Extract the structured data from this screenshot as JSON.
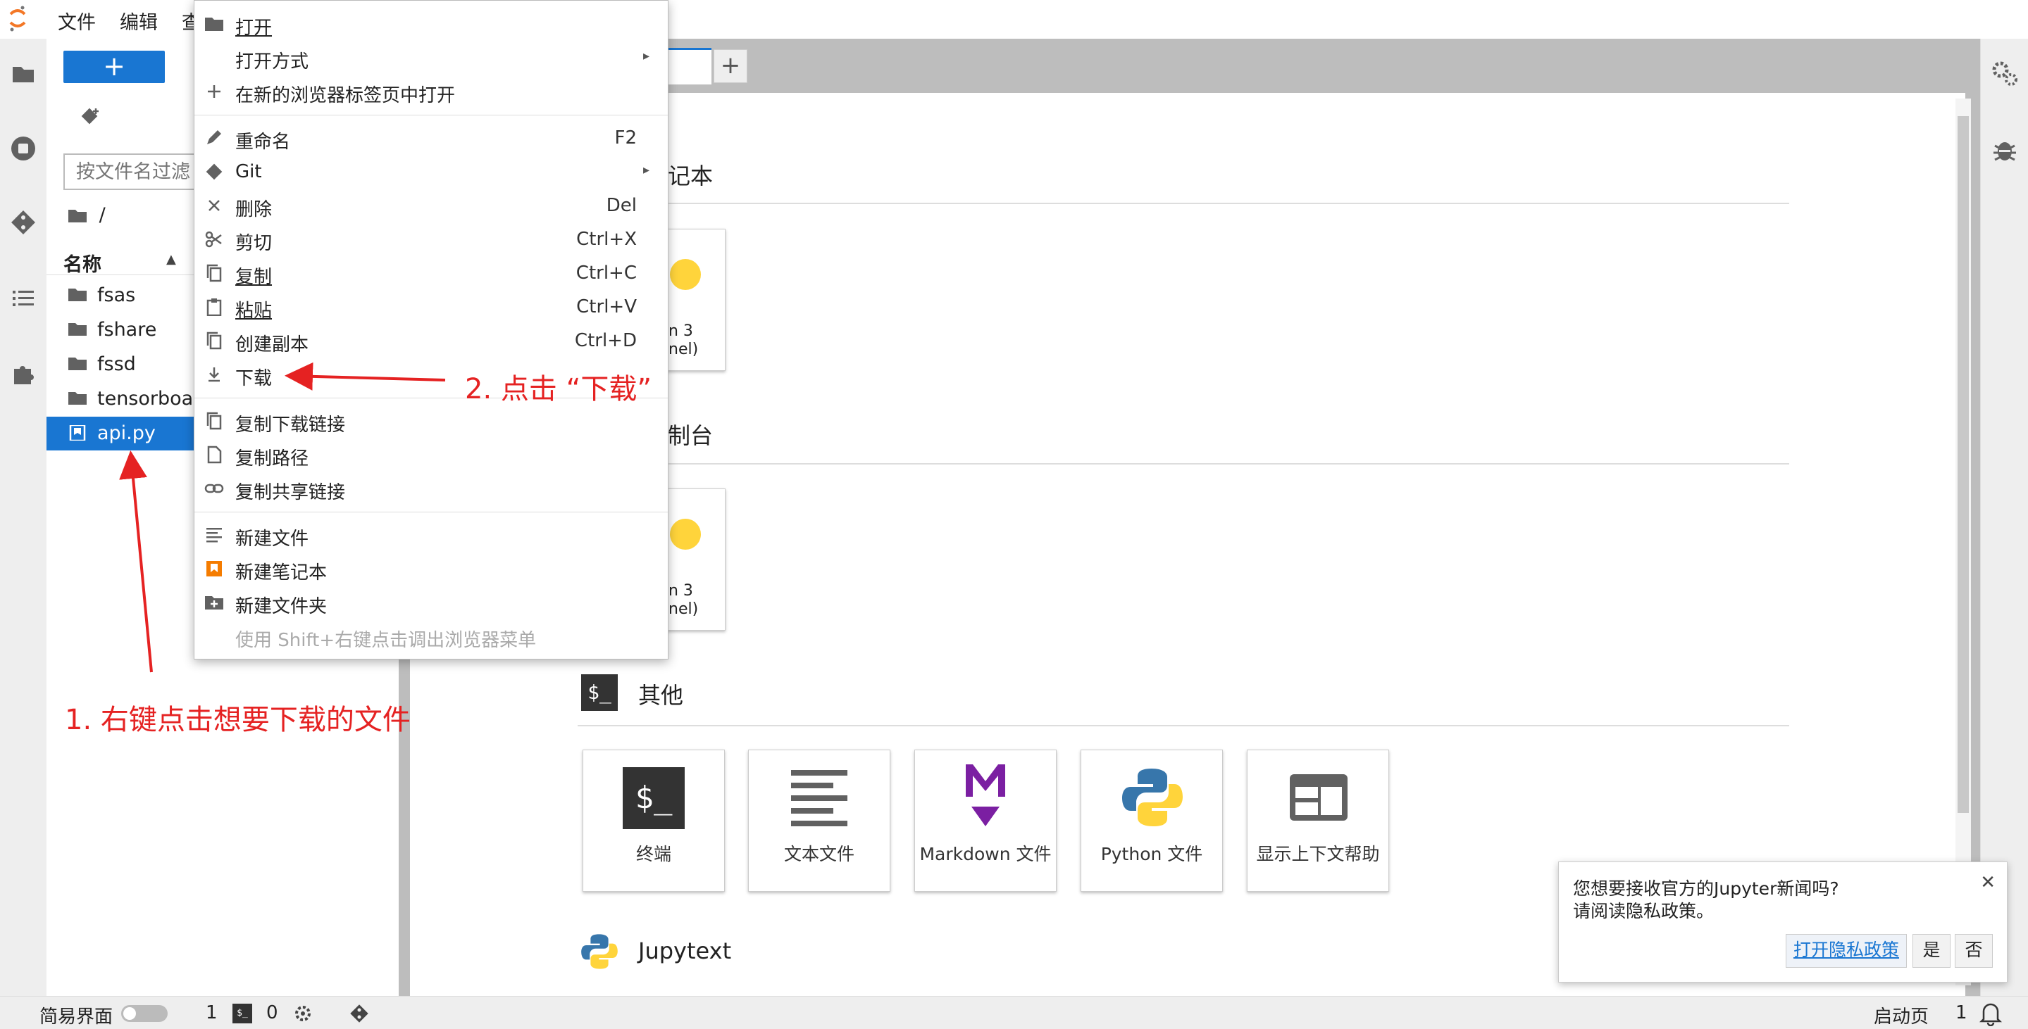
{
  "menubar": {
    "file": "文件",
    "edit": "编辑",
    "view_partial": "查"
  },
  "filebrowser": {
    "new_label": "+",
    "filter_placeholder": "按文件名过滤",
    "breadcrumb": "/",
    "column_name": "名称",
    "items": [
      {
        "name": "fsas",
        "type": "folder"
      },
      {
        "name": "fshare",
        "type": "folder"
      },
      {
        "name": "fssd",
        "type": "folder"
      },
      {
        "name": "tensorboa...",
        "type": "folder"
      },
      {
        "name": "api.py",
        "type": "file",
        "selected": true
      }
    ]
  },
  "launcher": {
    "tab_plus": "+",
    "notebook_section_partial": "记本",
    "console_section_partial": "制台",
    "kernel_partial_1": "n 3",
    "kernel_partial_2": "nel)",
    "other_section": "其他",
    "other_cards": [
      {
        "label": "终端",
        "icon": "terminal-icon"
      },
      {
        "label": "文本文件",
        "icon": "text-file-icon"
      },
      {
        "label": "Markdown 文件",
        "icon": "markdown-icon"
      },
      {
        "label": "Python 文件",
        "icon": "python-icon"
      },
      {
        "label": "显示上下文帮助",
        "icon": "context-help-icon"
      }
    ],
    "jupytext_section": "Jupytext",
    "terminal_glyph": "$_"
  },
  "context_menu": {
    "items": [
      {
        "label": "打开",
        "shortcut": "",
        "icon": "folder-icon"
      },
      {
        "label": "打开方式",
        "shortcut": "",
        "submenu": true
      },
      {
        "label": "在新的浏览器标签页中打开",
        "shortcut": "",
        "icon": "plus-icon"
      },
      {
        "label": "重命名",
        "shortcut": "F2",
        "icon": "pencil-icon"
      },
      {
        "label": "Git",
        "shortcut": "",
        "submenu": true,
        "icon": "git-icon"
      },
      {
        "label": "删除",
        "shortcut": "Del",
        "icon": "close-icon"
      },
      {
        "label": "剪切",
        "shortcut": "Ctrl+X",
        "icon": "scissors-icon"
      },
      {
        "label": "复制",
        "shortcut": "Ctrl+C",
        "icon": "copy-icon"
      },
      {
        "label": "粘贴",
        "shortcut": "Ctrl+V",
        "icon": "clipboard-icon"
      },
      {
        "label": "创建副本",
        "shortcut": "Ctrl+D",
        "icon": "duplicate-icon"
      },
      {
        "label": "下载",
        "shortcut": "",
        "icon": "download-icon"
      },
      {
        "label": "复制下载链接",
        "shortcut": "",
        "icon": "copy-icon"
      },
      {
        "label": "复制路径",
        "shortcut": "",
        "icon": "file-icon"
      },
      {
        "label": "复制共享链接",
        "shortcut": "",
        "icon": "link-icon"
      },
      {
        "label": "新建文件",
        "shortcut": "",
        "icon": "text-file-icon"
      },
      {
        "label": "新建笔记本",
        "shortcut": "",
        "icon": "notebook-icon"
      },
      {
        "label": "新建文件夹",
        "shortcut": "",
        "icon": "new-folder-icon"
      },
      {
        "label": "使用 Shift+右键点击调出浏览器菜单",
        "shortcut": "",
        "disabled": true
      }
    ]
  },
  "annotations": {
    "step1": "1. 右键点击想要下载的文件",
    "step2": "2. 点击 “下载”"
  },
  "toast": {
    "line1": "您想要接收官方的Jupyter新闻吗?",
    "line2": "请阅读隐私政策。",
    "privacy_link": "打开隐私政策",
    "yes": "是",
    "no": "否",
    "close": "✕"
  },
  "statusbar": {
    "simple_mode": "简易界面",
    "count1": "1",
    "count2": "0",
    "launcher": "启动页",
    "right_count": "1"
  },
  "colors": {
    "accent": "#1976d2",
    "annotation": "#e52222",
    "notebook_orange": "#f57c00"
  }
}
